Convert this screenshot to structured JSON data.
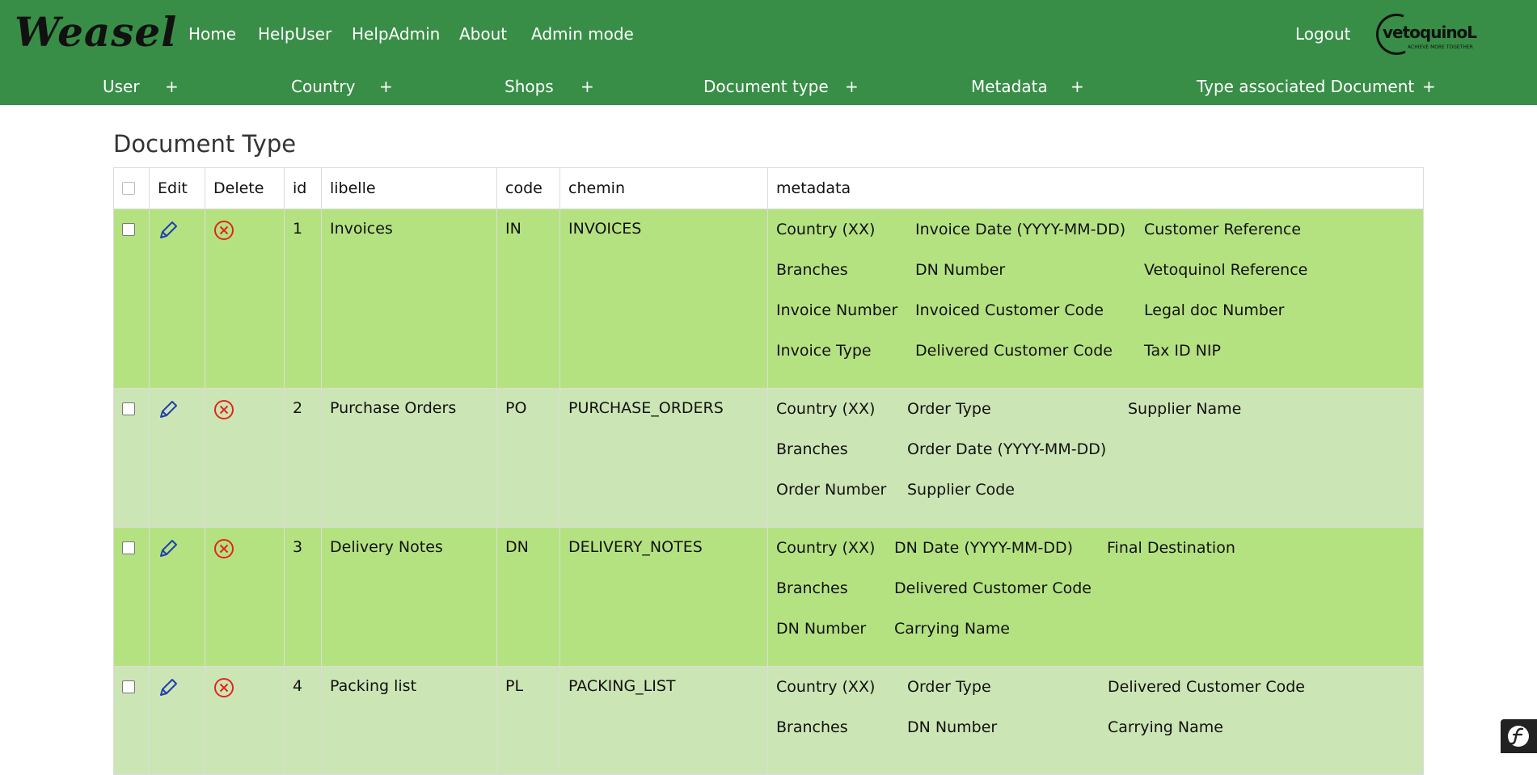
{
  "brand": {
    "name": "Weasel"
  },
  "nav": {
    "items": [
      "Home",
      "HelpUser",
      "HelpAdmin",
      "About",
      "Admin mode"
    ],
    "logout": "Logout"
  },
  "logo": {
    "text": "vetoquinoL",
    "tagline": "ACHIEVE MORE TOGETHER"
  },
  "subnav": [
    {
      "label": "User",
      "plus": "+"
    },
    {
      "label": "Country",
      "plus": "+"
    },
    {
      "label": "Shops",
      "plus": "+"
    },
    {
      "label": "Document type",
      "plus": "+"
    },
    {
      "label": "Metadata",
      "plus": "+"
    },
    {
      "label": "Type associated Document",
      "plus": "+"
    }
  ],
  "page": {
    "title": "Document Type"
  },
  "table": {
    "headers": [
      "Edit",
      "Delete",
      "id",
      "libelle",
      "code",
      "chemin",
      "metadata"
    ],
    "rows": [
      {
        "id": "1",
        "libelle": "Invoices",
        "code": "IN",
        "chemin": "INVOICES",
        "metadata": [
          "Country (XX)",
          "Invoice Date (YYYY-MM-DD)",
          "Customer Reference",
          "Branches",
          "DN Number",
          "Vetoquinol Reference",
          "Invoice Number",
          "Invoiced Customer Code",
          "Legal doc Number",
          "Invoice Type",
          "Delivered Customer Code",
          "Tax ID NIP"
        ]
      },
      {
        "id": "2",
        "libelle": "Purchase Orders",
        "code": "PO",
        "chemin": "PURCHASE_ORDERS",
        "metadata": [
          "Country (XX)",
          "Order Type",
          "Supplier Name",
          "Branches",
          "Order Date (YYYY-MM-DD)",
          "",
          "Order Number",
          "Supplier Code",
          ""
        ]
      },
      {
        "id": "3",
        "libelle": "Delivery Notes",
        "code": "DN",
        "chemin": "DELIVERY_NOTES",
        "metadata": [
          "Country (XX)",
          "DN Date (YYYY-MM-DD)",
          "Final Destination",
          "Branches",
          "Delivered Customer Code",
          "",
          "DN Number",
          "Carrying Name",
          ""
        ]
      },
      {
        "id": "4",
        "libelle": "Packing list",
        "code": "PL",
        "chemin": "PACKING_LIST",
        "metadata": [
          "Country (XX)",
          "Order Type",
          "Delivered Customer Code",
          "Branches",
          "DN Number",
          "Carrying Name"
        ]
      }
    ]
  },
  "colors": {
    "header_green": "#388e46",
    "row_dark": "#b5e281",
    "row_light": "#cce5b4",
    "edit_icon": "#1f3fb0",
    "delete_icon": "#e0261c"
  },
  "icons": {
    "edit": "pencil-icon",
    "delete": "close-circle-icon",
    "debug": "symfony-icon"
  }
}
